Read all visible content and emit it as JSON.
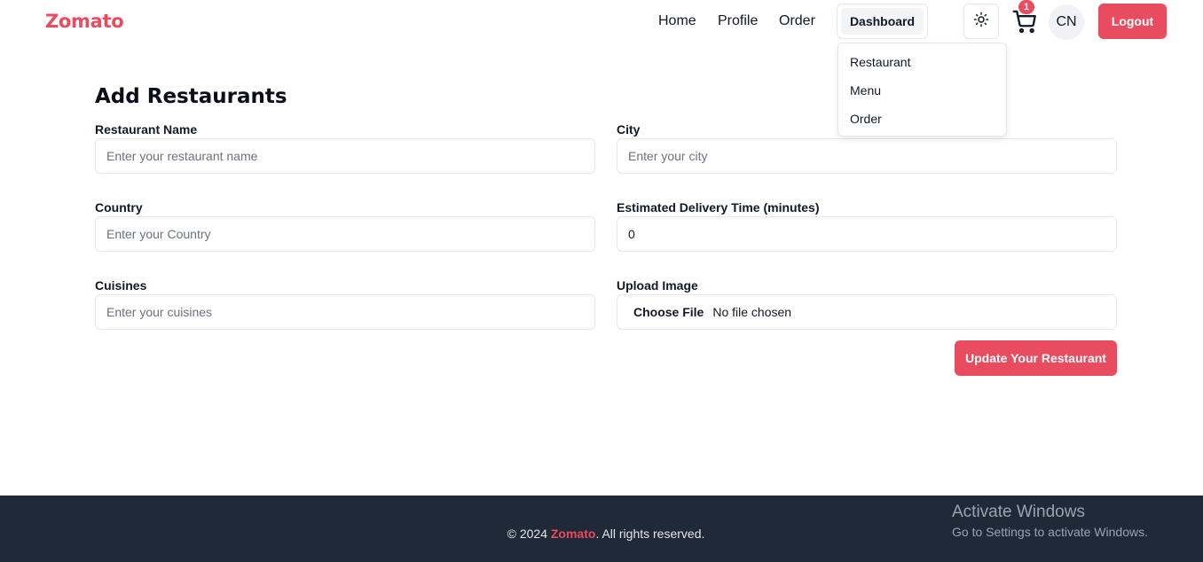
{
  "nav": {
    "brand": "Zomato",
    "links": [
      "Home",
      "Profile",
      "Order"
    ],
    "dashboard": "Dashboard",
    "theme_icon": "sun-icon",
    "cart_icon": "cart-icon",
    "cart_count": "1",
    "avatar": "CN",
    "logout": "Logout"
  },
  "dropdown": {
    "items": [
      "Restaurant",
      "Menu",
      "Order"
    ]
  },
  "form": {
    "title": "Add Restaurants",
    "restaurant_name": {
      "label": "Restaurant Name",
      "placeholder": "Enter your restaurant name",
      "value": ""
    },
    "city": {
      "label": "City",
      "placeholder": "Enter your city",
      "value": ""
    },
    "country": {
      "label": "Country",
      "placeholder": "Enter your Country",
      "value": ""
    },
    "delivery_time": {
      "label": "Estimated Delivery Time (minutes)",
      "placeholder": "",
      "value": "0"
    },
    "cuisines": {
      "label": "Cuisines",
      "placeholder": "Enter your cuisines",
      "value": ""
    },
    "upload": {
      "label": "Upload Image",
      "button": "Choose File",
      "status": "No file chosen"
    },
    "submit": "Update Your Restaurant"
  },
  "footer": {
    "prefix": "© 2024 ",
    "brand": "Zomato",
    "suffix": ". All rights reserved."
  },
  "watermark": {
    "title": "Activate Windows",
    "subtitle": "Go to Settings to activate Windows."
  },
  "colors": {
    "accent": "#e94b5f",
    "footer_bg": "#1f2937"
  }
}
